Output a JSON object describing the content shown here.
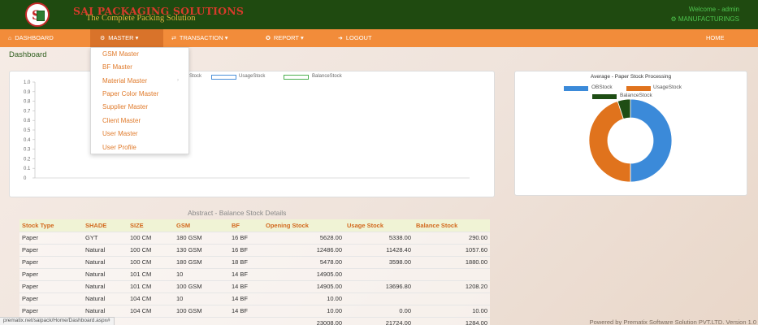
{
  "header": {
    "brand": "SAI PACKAGING SOLUTIONS",
    "tagline": "The Complete Packing Solution",
    "welcome": "Welcome - admin",
    "org": "MANUFACTURINGS"
  },
  "menu": {
    "dashboard": "DASHBOARD",
    "master": "MASTER",
    "transaction": "TRANSACTION",
    "report": "REPORT",
    "logout": "LOGOUT",
    "home": "HOME"
  },
  "dropdown": {
    "items": [
      "GSM Master",
      "BF Master",
      "Material Master",
      "Paper Color Master",
      "Supplier Master",
      "Client Master",
      "User Master",
      "User Profile"
    ]
  },
  "page_title": "Dashboard",
  "chart_data": [
    {
      "type": "bar",
      "title": "",
      "legend": [
        "OBStock",
        "UsageStock",
        "BalanceStock"
      ],
      "legend_visible": [
        "Stock",
        "UsageStock",
        "BalanceStock"
      ],
      "series": [],
      "ylim": [
        0,
        1.0
      ],
      "yticks": [
        "1.0",
        "0.9",
        "0.8",
        "0.7",
        "0.6",
        "0.5",
        "0.4",
        "0.3",
        "0.2",
        "0.1",
        "0"
      ],
      "grid": false,
      "legend_position": "top"
    },
    {
      "type": "pie",
      "title": "Average - Paper Stock Processing",
      "labels": [
        "OBStock",
        "UsageStock",
        "BalanceStock"
      ],
      "values": [
        50,
        45,
        5
      ],
      "colors": [
        "#3b8ad9",
        "#e0731d",
        "#1e4d14"
      ],
      "legend_position": "top"
    }
  ],
  "table": {
    "caption": "Abstract - Balance Stock Details",
    "columns": [
      "Stock Type",
      "SHADE",
      "SIZE",
      "GSM",
      "BF",
      "Opening Stock",
      "Usage Stock",
      "Balance Stock"
    ],
    "rows": [
      [
        "Paper",
        "GYT",
        "100 CM",
        "180 GSM",
        "16 BF",
        "5628.00",
        "5338.00",
        "290.00"
      ],
      [
        "Paper",
        "Natural",
        "100 CM",
        "130 GSM",
        "16 BF",
        "12486.00",
        "11428.40",
        "1057.60"
      ],
      [
        "Paper",
        "Natural",
        "100 CM",
        "180 GSM",
        "18 BF",
        "5478.00",
        "3598.00",
        "1880.00"
      ],
      [
        "Paper",
        "Natural",
        "101 CM",
        "10",
        "14 BF",
        "14905.00",
        "",
        ""
      ],
      [
        "Paper",
        "Natural",
        "101 CM",
        "100 GSM",
        "14 BF",
        "14905.00",
        "13696.80",
        "1208.20"
      ],
      [
        "Paper",
        "Natural",
        "104 CM",
        "10",
        "14 BF",
        "10.00",
        "",
        ""
      ],
      [
        "Paper",
        "Natural",
        "104 CM",
        "100 GSM",
        "14 BF",
        "10.00",
        "0.00",
        "10.00"
      ],
      [
        "",
        "",
        "",
        "",
        "",
        "23008.00",
        "21724.00",
        "1284.00"
      ]
    ]
  },
  "status_url": "prematix.net/saipack/Home/Dashboard.aspx#",
  "footer": "Powered by Prematix Software Solution PVT.LTD. Version 1.0",
  "colors": {
    "header": "#1f4a10",
    "menu": "#f28c3a",
    "accent": "#e07b2c"
  }
}
